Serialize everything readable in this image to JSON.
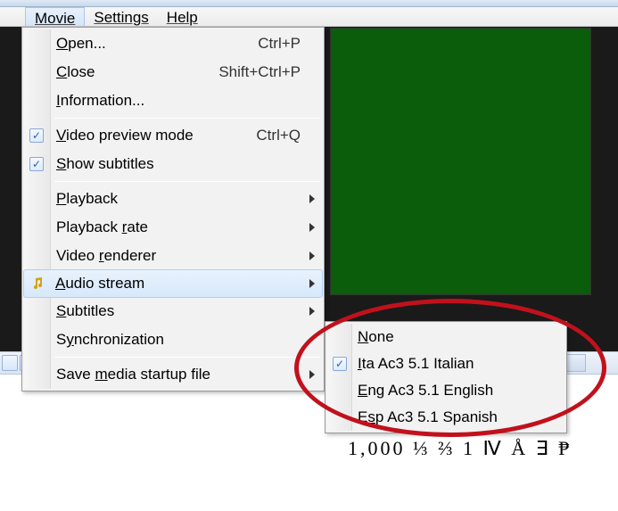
{
  "menubar": {
    "items": [
      {
        "label": "Movie",
        "open": true
      },
      {
        "label": "Settings",
        "open": false
      },
      {
        "label": "Help",
        "open": false
      }
    ]
  },
  "movie_menu": {
    "open": {
      "label": "Open...",
      "ul": "O",
      "rest": "pen...",
      "shortcut": "Ctrl+P"
    },
    "close": {
      "label": "Close",
      "ul": "C",
      "rest": "lose",
      "shortcut": "Shift+Ctrl+P"
    },
    "information": {
      "label": "Information...",
      "ul": "I",
      "rest": "nformation..."
    },
    "video_preview": {
      "label": "Video preview mode",
      "ul": "V",
      "rest": "ideo preview mode",
      "shortcut": "Ctrl+Q",
      "checked": true
    },
    "show_subtitles": {
      "label": "Show subtitles",
      "ul": "S",
      "rest": "how subtitles",
      "checked": true
    },
    "playback": {
      "label": "Playback",
      "ul": "P",
      "rest": "layback"
    },
    "playback_rate": {
      "label": "Playback rate",
      "pre": "Playback ",
      "ul": "r",
      "rest": "ate"
    },
    "video_renderer": {
      "label": "Video renderer",
      "pre": "Video ",
      "ul": "r",
      "rest": "enderer"
    },
    "audio_stream": {
      "label": "Audio stream",
      "ul": "A",
      "rest": "udio stream"
    },
    "subtitles": {
      "label": "Subtitles",
      "ul": "S",
      "rest": "ubtitles"
    },
    "sync": {
      "label": "Synchronization",
      "pre": "S",
      "ul": "y",
      "rest": "nchronization"
    },
    "save_startup": {
      "label": "Save media startup file",
      "pre": "Save ",
      "ul": "m",
      "rest": "edia startup file"
    }
  },
  "audio_submenu": {
    "none": {
      "label": "None",
      "ul": "N",
      "rest": "one"
    },
    "ita": {
      "label": "Ita Ac3 5.1 Italian",
      "ul": "I",
      "rest": "ta Ac3 5.1 Italian",
      "checked": true
    },
    "eng": {
      "label": "Eng Ac3 5.1 English",
      "ul": "E",
      "rest": "ng Ac3 5.1 English"
    },
    "esp": {
      "label": "Esp Ac3 5.1 Spanish",
      "pre": "E",
      "ul": "s",
      "rest": "p Ac3 5.1 Spanish"
    }
  },
  "doc": {
    "sample_text": "1,000 ⅓ ⅔ 1 Ⅳ Å ∃ ₱"
  },
  "colors": {
    "video_bg": "#0b5c0b",
    "annotation": "#c1111c"
  }
}
